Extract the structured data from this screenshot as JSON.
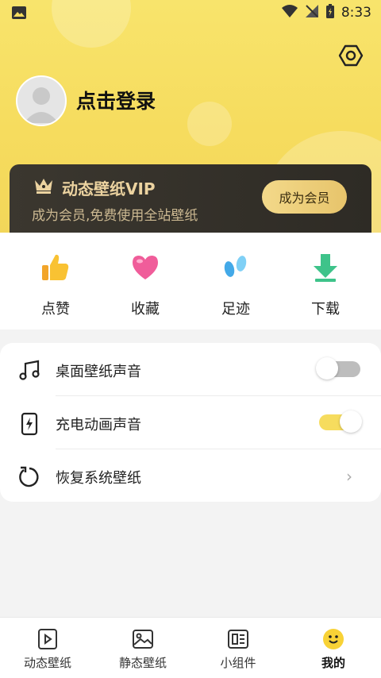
{
  "status": {
    "time": "8:33"
  },
  "profile": {
    "login_label": "点击登录"
  },
  "vip": {
    "title": "动态壁纸VIP",
    "description": "成为会员,免费使用全站壁纸",
    "button": "成为会员"
  },
  "quick_actions": [
    {
      "label": "点赞",
      "icon": "thumbs-up-icon"
    },
    {
      "label": "收藏",
      "icon": "heart-icon"
    },
    {
      "label": "足迹",
      "icon": "footprints-icon"
    },
    {
      "label": "下载",
      "icon": "download-icon"
    }
  ],
  "settings": [
    {
      "label": "桌面壁纸声音",
      "icon": "music-note-icon",
      "toggle": "off"
    },
    {
      "label": "充电动画声音",
      "icon": "charging-icon",
      "toggle": "on"
    },
    {
      "label": "恢复系统壁纸",
      "icon": "restore-icon",
      "chevron": true
    }
  ],
  "tabs": [
    {
      "label": "动态壁纸",
      "icon": "video-play-icon",
      "active": false
    },
    {
      "label": "静态壁纸",
      "icon": "image-icon",
      "active": false
    },
    {
      "label": "小组件",
      "icon": "widget-icon",
      "active": false
    },
    {
      "label": "我的",
      "icon": "smiley-icon",
      "active": true
    }
  ],
  "colors": {
    "accent": "#F6DC5E",
    "vip_gold": "#ECD3A0",
    "vip_bg": "#2E2B25"
  }
}
